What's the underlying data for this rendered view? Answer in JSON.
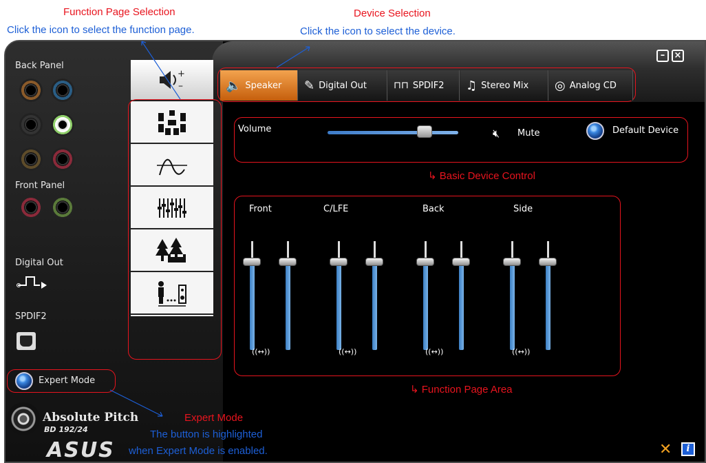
{
  "annotations": {
    "function_page_title": "Function Page Selection",
    "function_page_desc": "Click the icon to select the function page.",
    "device_selection_title": "Device Selection",
    "device_selection_desc": "Click the icon to select the device.",
    "basic_device_control": "Basic Device Control",
    "function_page_area": "Function Page Area",
    "expert_mode_title": "Expert Mode",
    "expert_mode_desc_1": "The button is highlighted",
    "expert_mode_desc_2": "when Expert Mode is enabled."
  },
  "left_panel": {
    "back_panel_label": "Back Panel",
    "front_panel_label": "Front Panel",
    "digital_out_label": "Digital Out",
    "spdif2_label": "SPDIF2",
    "expert_mode_label": "Expert Mode",
    "logo_text_1": "Absolute Pitch",
    "logo_text_2": "BD 192/24",
    "asus_logo": "ASUS"
  },
  "device_tabs": [
    {
      "label": "Speaker",
      "icon": "speaker-icon",
      "selected": true
    },
    {
      "label": "Digital Out",
      "icon": "plug-icon",
      "selected": false
    },
    {
      "label": "SPDIF2",
      "icon": "pulse-icon",
      "selected": false
    },
    {
      "label": "Stereo Mix",
      "icon": "music-note-icon",
      "selected": false
    },
    {
      "label": "Analog CD",
      "icon": "cd-icon",
      "selected": false
    }
  ],
  "function_pages": [
    {
      "name": "volume-page",
      "icon": "volume-icon",
      "selected": true
    },
    {
      "name": "speaker-config-page",
      "icon": "speaker-config-icon"
    },
    {
      "name": "eq-curve-page",
      "icon": "wave-icon"
    },
    {
      "name": "equalizer-page",
      "icon": "equalizer-icon"
    },
    {
      "name": "environment-page",
      "icon": "environment-icon"
    },
    {
      "name": "distance-page",
      "icon": "listener-distance-icon"
    }
  ],
  "basic_control": {
    "volume_label": "Volume",
    "volume_level": 0.74,
    "mute_label": "Mute",
    "default_device_label": "Default Device"
  },
  "channels": [
    {
      "label": "Front",
      "balance": "((↔))",
      "left_level": 0.8,
      "right_level": 0.8
    },
    {
      "label": "C/LFE",
      "balance": "((↔))",
      "left_level": 0.8,
      "right_level": 0.8
    },
    {
      "label": "Back",
      "balance": "((↔))",
      "left_level": 0.8,
      "right_level": 0.8
    },
    {
      "label": "Side",
      "balance": "((↔))",
      "left_level": 0.8,
      "right_level": 0.8
    }
  ],
  "colors": {
    "accent_orange": "#e27a1e",
    "annotation_red": "#e8141e",
    "annotation_blue": "#1d5fd6",
    "slider_blue": "#5a9bdc"
  }
}
